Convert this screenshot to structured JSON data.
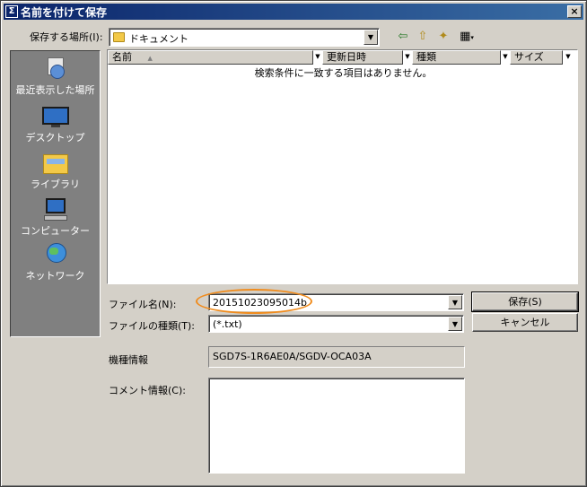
{
  "window": {
    "title": "名前を付けて保存",
    "close_glyph": "×",
    "icon_glyph": "Σ"
  },
  "save_in": {
    "label": "保存する場所(I):",
    "value": "ドキュメント"
  },
  "toolbar": {
    "back_glyph": "⇦",
    "up_glyph": "⇧",
    "newfolder_glyph": "✦",
    "view_glyph": "▦"
  },
  "places": [
    {
      "label": "最近表示した場所"
    },
    {
      "label": "デスクトップ"
    },
    {
      "label": "ライブラリ"
    },
    {
      "label": "コンピューター"
    },
    {
      "label": "ネットワーク"
    }
  ],
  "columns": [
    {
      "label": "名前"
    },
    {
      "label": "更新日時"
    },
    {
      "label": "種類"
    },
    {
      "label": "サイズ"
    }
  ],
  "empty_message": "検索条件に一致する項目はありません。",
  "filename": {
    "label": "ファイル名(N):",
    "value": "20151023095014b"
  },
  "filetype": {
    "label": "ファイルの種類(T):",
    "value": "(*.txt)"
  },
  "buttons": {
    "save": "保存(S)",
    "cancel": "キャンセル"
  },
  "model_info": {
    "label": "機種情報",
    "value": "SGD7S-1R6AE0A/SGDV-OCA03A"
  },
  "comment": {
    "label": "コメント情報(C):",
    "value": ""
  },
  "colors": {
    "highlight": "#f08c1e",
    "titlebar": "#0a246a"
  }
}
